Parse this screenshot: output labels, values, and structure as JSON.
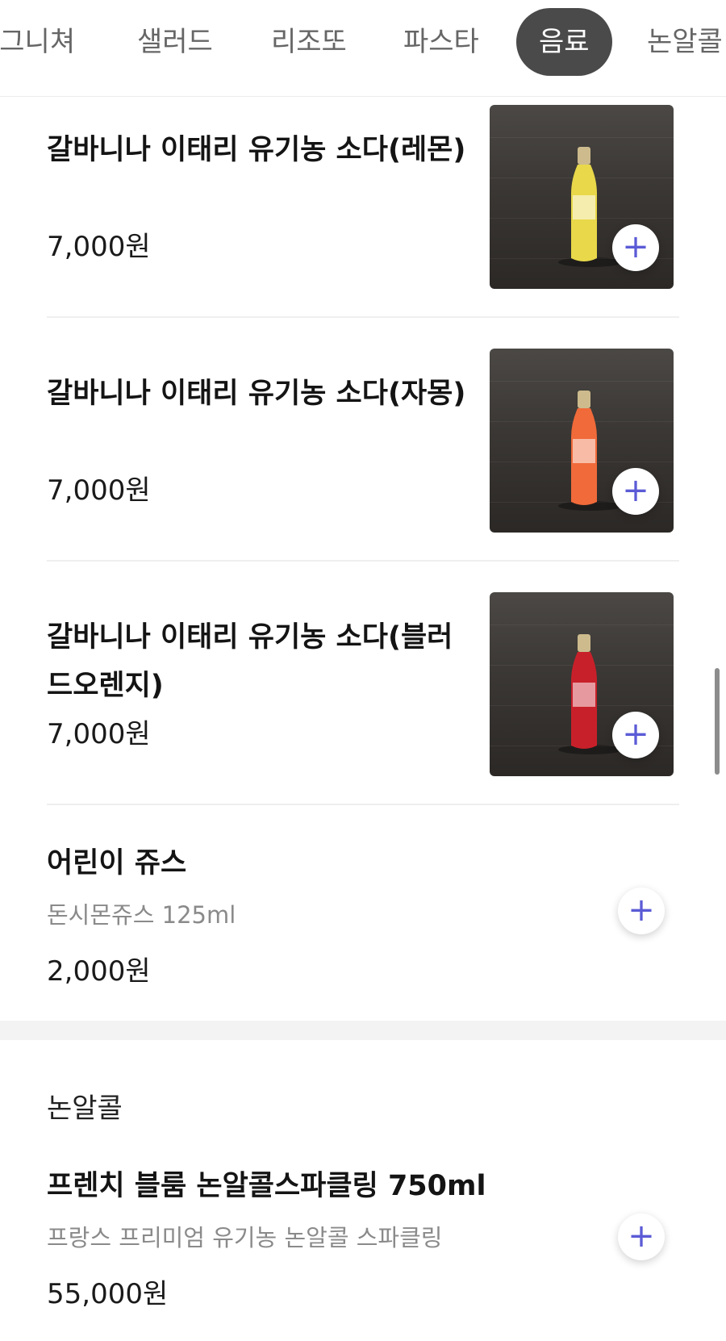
{
  "tabs": [
    {
      "label": "시그니쳐"
    },
    {
      "label": "샐러드"
    },
    {
      "label": "리조또"
    },
    {
      "label": "파스타"
    },
    {
      "label": "음료",
      "active": true
    },
    {
      "label": "논알콜"
    }
  ],
  "items": [
    {
      "name": "갈바니나 이태리 유기농 소다(레몬)",
      "price": "7,000원",
      "has_image": true,
      "bottle_color": "#e8d84a"
    },
    {
      "name": "갈바니나 이태리 유기농 소다(자몽)",
      "price": "7,000원",
      "has_image": true,
      "bottle_color": "#f06a3a"
    },
    {
      "name": "갈바니나 이태리 유기농 소다(블러드오렌지)",
      "price": "7,000원",
      "has_image": true,
      "bottle_color": "#c8202a"
    },
    {
      "name": "어린이 쥬스",
      "description": "돈시몬쥬스 125ml",
      "price": "2,000원",
      "has_image": false
    }
  ],
  "section": {
    "title": "논알콜",
    "items": [
      {
        "name": "프렌치 블룸 논알콜스파클링 750ml",
        "description": "프랑스 프리미엄 유기농 논알콜 스파클링",
        "price": "55,000원"
      }
    ]
  },
  "icons": {
    "add": "plus-icon"
  },
  "colors": {
    "accent": "#5b5bd6",
    "active_tab": "#4a4a4a"
  }
}
